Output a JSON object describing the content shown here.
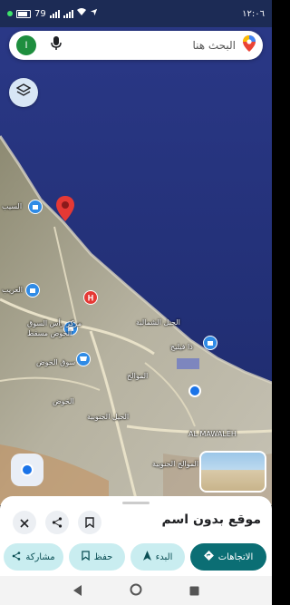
{
  "status": {
    "time": "١٢:٠٦",
    "battery": "79"
  },
  "search": {
    "placeholder": "البحث هنا",
    "avatar_letter": "I"
  },
  "map_labels": {
    "seeb": "السيب",
    "west_amerat": "العريب",
    "ras_market": "مركز رأس السوق",
    "khoudh_muscat": "الخوض مسقط",
    "souq_khoudh": "سوق الخوض",
    "jabal_north": "الجبل الشمالية",
    "the_village": "ذا فيليج",
    "al_mawaleh": "AL MAWALEH",
    "mawaleh_south": "الموالح الجنوبية",
    "mawaleh_mid": "الموالح",
    "hail_south": "الحيل الجنوبية",
    "khoudh": "الخوض"
  },
  "sheet": {
    "title": "موقع بدون اسم",
    "directions": "الاتجاهات",
    "start": "البدء",
    "save": "حفظ",
    "share": "مشاركة"
  },
  "colors": {
    "sea": "#23317a",
    "land": "#b9b6a6",
    "accent": "#0b6e74",
    "chip": "#c9edf0",
    "pin": "#e53935"
  }
}
